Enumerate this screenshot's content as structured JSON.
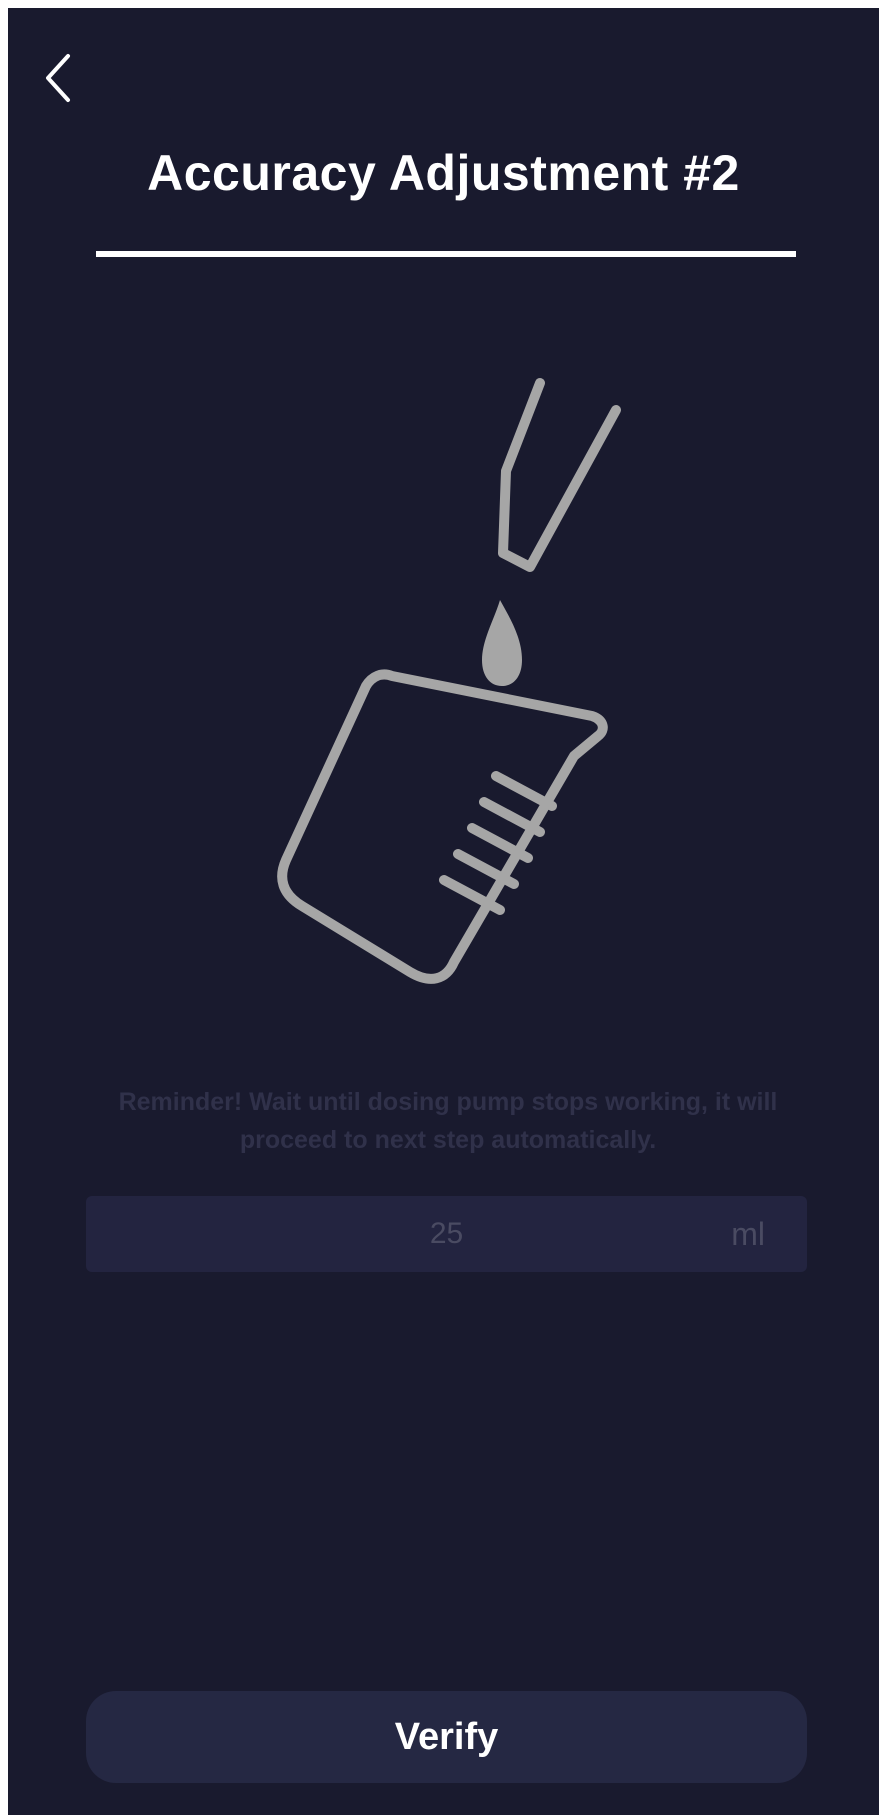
{
  "header": {
    "back_icon": "chevron-left-icon",
    "title": "Accuracy Adjustment #2"
  },
  "illustration": {
    "icon": "beaker-pipette-icon",
    "color": "#a6a6a6"
  },
  "reminder": {
    "text": "Reminder! Wait until dosing pump stops working, it will proceed to next step automatically."
  },
  "volume": {
    "value": "25",
    "unit": "ml"
  },
  "actions": {
    "verify_label": "Verify"
  },
  "colors": {
    "background": "#191a2e",
    "field": "#232440",
    "button": "#252843"
  }
}
